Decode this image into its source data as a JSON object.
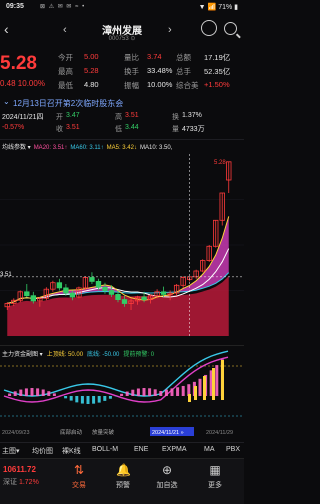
{
  "status": {
    "time": "09:35",
    "icons": "⊠ ⚠ ✉ ✉ ≈ •",
    "right": "▼ 📶 71% ▮"
  },
  "nav": {
    "title": "漳州发展",
    "code": "000753 ⊙",
    "back": "‹",
    "prev": "‹",
    "next": "›"
  },
  "quote": {
    "price": "5.28",
    "change": "0.48 10.00%",
    "cells": [
      {
        "label": "今开",
        "value": "5.00",
        "vclass": "red"
      },
      {
        "label": "量比",
        "value": "3.74",
        "vclass": "red"
      },
      {
        "label": "总额",
        "value": "17.19亿",
        "vclass": "white"
      },
      {
        "label": "最高",
        "value": "5.28",
        "vclass": "red"
      },
      {
        "label": "换手",
        "value": "33.48%",
        "vclass": "white"
      },
      {
        "label": "总手",
        "value": "52.35亿",
        "vclass": "white"
      },
      {
        "label": "最低",
        "value": "4.80",
        "vclass": "white"
      },
      {
        "label": "振幅",
        "value": "10.00%",
        "vclass": "white"
      },
      {
        "label": "综合美",
        "value": "+1.50%",
        "vclass": "red"
      }
    ]
  },
  "banner": {
    "text": "12月13日召开第2次临时股东会"
  },
  "ohlc": {
    "date": "2024/11/21四",
    "open_label": "开",
    "open": "3.47",
    "high_label": "高",
    "high": "3.51",
    "turn_label": "换",
    "turn": "1.37%",
    "chg": "-0.57%",
    "close_label": "收",
    "close": "3.51",
    "low_label": "低",
    "low": "3.44",
    "vol_label": "量",
    "vol": "4733万"
  },
  "ma": {
    "label": "均线参数 ▾",
    "items": [
      {
        "text": "MA20: 3.51↑",
        "color": "#ff4fa0"
      },
      {
        "text": "MA60: 3.11↑",
        "color": "#39c9e8"
      },
      {
        "text": "MA5: 3.42↓",
        "color": "#ffd23a"
      },
      {
        "text": "MA10: 3.50,",
        "color": "#e6e6e6"
      }
    ],
    "price_top": "5.28",
    "price_mid": "3.51"
  },
  "indicator": {
    "name": "主力资金副图 ▾",
    "items": [
      {
        "text": "上顶线: 50.00",
        "color": "#ffd23a"
      },
      {
        "text": "底线: -50.00",
        "color": "#39c9e8"
      },
      {
        "text": "提前预警: 0",
        "color": "#33cc66"
      }
    ],
    "date_left": "2024/09/23",
    "mark1": "底部启动",
    "mark2": "放量突破",
    "date_cursor": "2024/11/21 »",
    "date_right": "2024/11/29"
  },
  "tabs": [
    {
      "label": "主图▾"
    },
    {
      "label": "均价图"
    },
    {
      "label": "裸K线"
    },
    {
      "label": "BOLL-M"
    },
    {
      "label": "ENE"
    },
    {
      "label": "EXPMA"
    },
    {
      "label": "MA"
    },
    {
      "label": "PBX"
    }
  ],
  "bottom": {
    "index_value": "10611.72",
    "index_name": "深证",
    "index_chg": "1.72%",
    "items": [
      {
        "label": "交易",
        "icon": "trade-icon",
        "active": true
      },
      {
        "label": "预警",
        "icon": "bell-icon",
        "active": false
      },
      {
        "label": "加自选",
        "icon": "plus-icon",
        "active": false
      },
      {
        "label": "更多",
        "icon": "grid-icon",
        "active": false
      }
    ]
  },
  "chart_data": {
    "type": "candlestick",
    "price_range": [
      2.6,
      5.4
    ],
    "candles": [
      [
        3.05,
        3.12,
        3.0,
        3.1
      ],
      [
        3.1,
        3.18,
        3.06,
        3.15
      ],
      [
        3.15,
        3.3,
        3.12,
        3.28
      ],
      [
        3.28,
        3.4,
        3.2,
        3.22
      ],
      [
        3.22,
        3.28,
        3.1,
        3.14
      ],
      [
        3.14,
        3.2,
        3.05,
        3.18
      ],
      [
        3.18,
        3.35,
        3.15,
        3.32
      ],
      [
        3.32,
        3.45,
        3.28,
        3.42
      ],
      [
        3.42,
        3.48,
        3.3,
        3.34
      ],
      [
        3.34,
        3.4,
        3.22,
        3.26
      ],
      [
        3.26,
        3.3,
        3.15,
        3.2
      ],
      [
        3.2,
        3.36,
        3.18,
        3.34
      ],
      [
        3.34,
        3.52,
        3.3,
        3.5
      ],
      [
        3.5,
        3.58,
        3.4,
        3.44
      ],
      [
        3.44,
        3.48,
        3.3,
        3.35
      ],
      [
        3.35,
        3.42,
        3.25,
        3.3
      ],
      [
        3.3,
        3.38,
        3.2,
        3.24
      ],
      [
        3.24,
        3.3,
        3.12,
        3.16
      ],
      [
        3.16,
        3.22,
        3.05,
        3.1
      ],
      [
        3.1,
        3.18,
        3.0,
        3.14
      ],
      [
        3.14,
        3.22,
        3.08,
        3.2
      ],
      [
        3.2,
        3.28,
        3.12,
        3.16
      ],
      [
        3.16,
        3.24,
        3.1,
        3.22
      ],
      [
        3.22,
        3.32,
        3.18,
        3.28
      ],
      [
        3.28,
        3.36,
        3.2,
        3.24
      ],
      [
        3.24,
        3.3,
        3.15,
        3.26
      ],
      [
        3.26,
        3.4,
        3.22,
        3.38
      ],
      [
        3.38,
        3.52,
        3.34,
        3.5
      ],
      [
        3.47,
        3.51,
        3.44,
        3.51
      ],
      [
        3.51,
        3.62,
        3.48,
        3.6
      ],
      [
        3.6,
        3.78,
        3.58,
        3.76
      ],
      [
        3.76,
        4.0,
        3.74,
        3.98
      ],
      [
        3.98,
        4.38,
        3.96,
        4.38
      ],
      [
        4.38,
        4.8,
        4.3,
        4.8
      ],
      [
        5.0,
        5.28,
        4.8,
        5.28
      ]
    ]
  }
}
